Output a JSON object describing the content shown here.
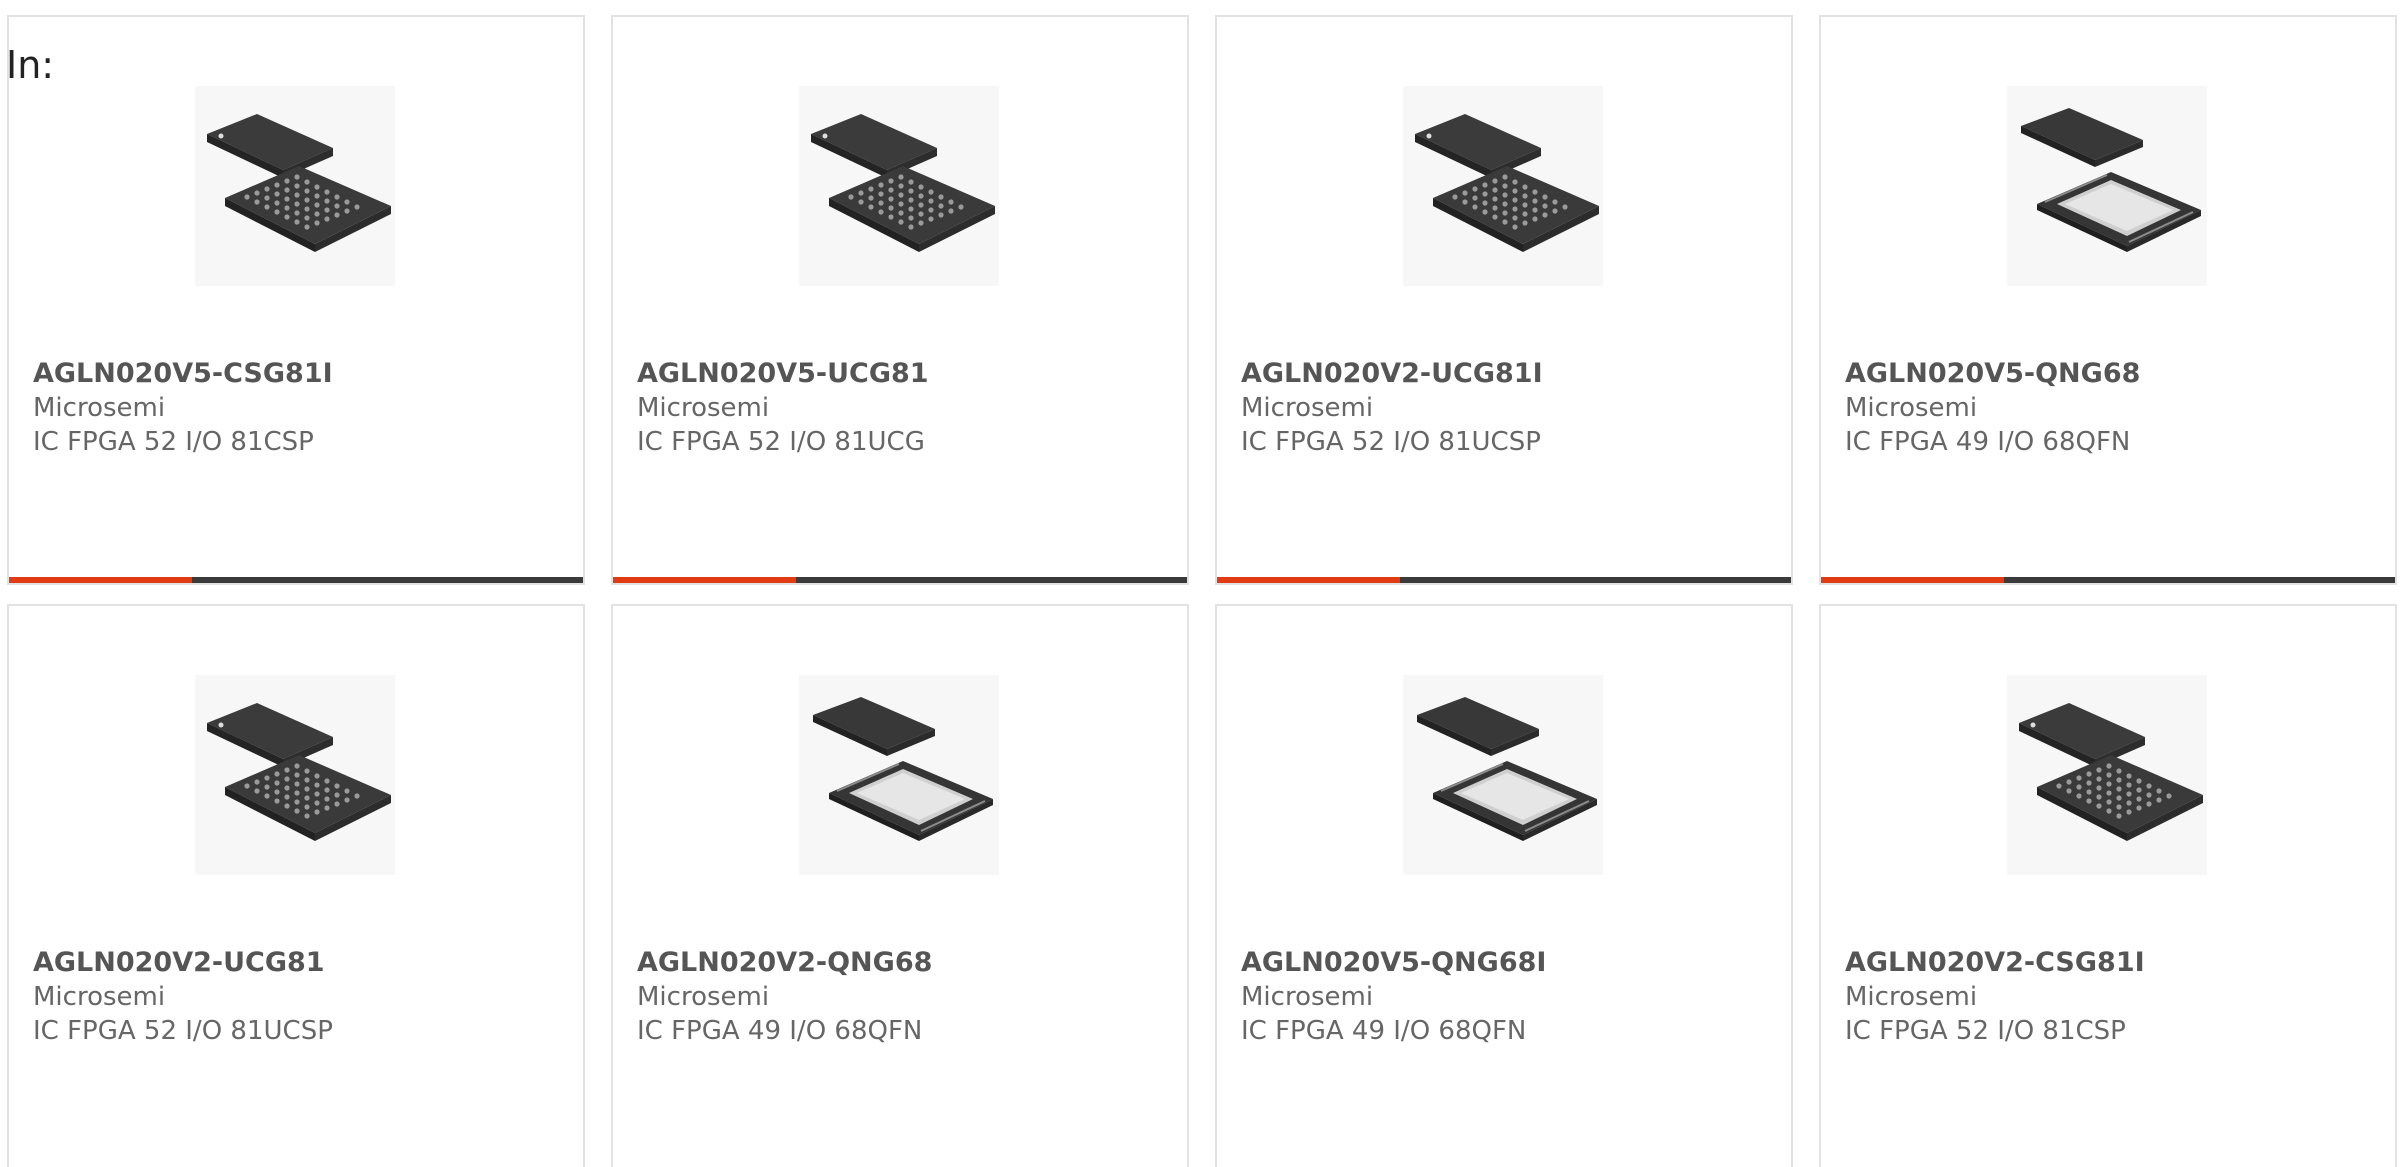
{
  "header": {
    "label": "In:"
  },
  "accent_color": "#e23b13",
  "bar_color": "#3a3a3a",
  "products": [
    {
      "part_number": "AGLN020V5-CSG81I",
      "manufacturer": "Microsemi",
      "description": "IC FPGA 52 I/O 81CSP",
      "package_icon": "bga-chip-icon"
    },
    {
      "part_number": "AGLN020V5-UCG81",
      "manufacturer": "Microsemi",
      "description": "IC FPGA 52 I/O 81UCG",
      "package_icon": "bga-chip-icon"
    },
    {
      "part_number": "AGLN020V2-UCG81I",
      "manufacturer": "Microsemi",
      "description": "IC FPGA 52 I/O 81UCSP",
      "package_icon": "bga-chip-icon"
    },
    {
      "part_number": "AGLN020V5-QNG68",
      "manufacturer": "Microsemi",
      "description": "IC FPGA 49 I/O 68QFN",
      "package_icon": "qfn-chip-icon"
    },
    {
      "part_number": "AGLN020V2-UCG81",
      "manufacturer": "Microsemi",
      "description": "IC FPGA 52 I/O 81UCSP",
      "package_icon": "bga-chip-icon"
    },
    {
      "part_number": "AGLN020V2-QNG68",
      "manufacturer": "Microsemi",
      "description": "IC FPGA 49 I/O 68QFN",
      "package_icon": "qfn-chip-icon"
    },
    {
      "part_number": "AGLN020V5-QNG68I",
      "manufacturer": "Microsemi",
      "description": "IC FPGA 49 I/O 68QFN",
      "package_icon": "qfn-chip-icon"
    },
    {
      "part_number": "AGLN020V2-CSG81I",
      "manufacturer": "Microsemi",
      "description": "IC FPGA 52 I/O 81CSP",
      "package_icon": "bga-chip-icon"
    }
  ]
}
